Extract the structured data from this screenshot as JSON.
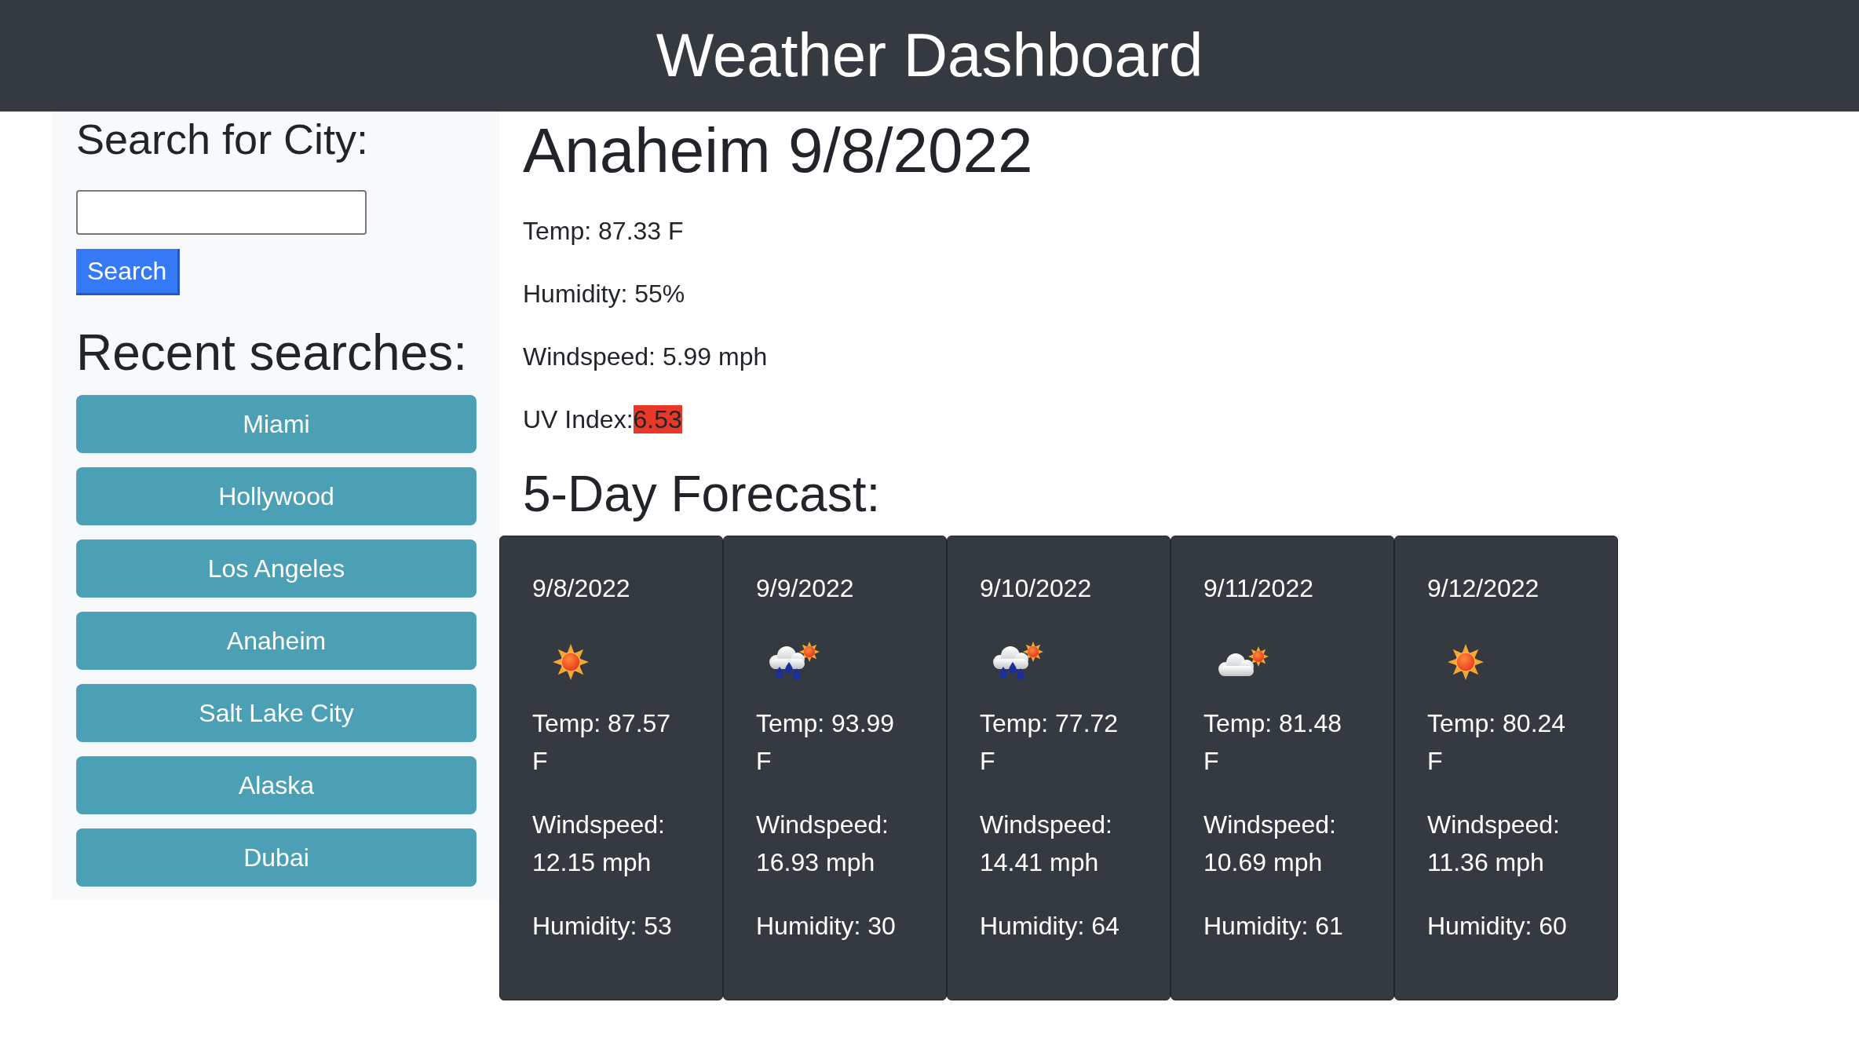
{
  "header": {
    "title": "Weather Dashboard"
  },
  "sidebar": {
    "search_heading": "Search for City:",
    "search_button": "Search",
    "recent_heading": "Recent searches:",
    "recent_searches": [
      "Miami",
      "Hollywood",
      "Los Angeles",
      "Anaheim",
      "Salt Lake City",
      "Alaska",
      "Dubai"
    ]
  },
  "current": {
    "title": "Anaheim 9/8/2022",
    "temp": "Temp: 87.33 F",
    "humidity": "Humidity: 55%",
    "windspeed": "Windspeed: 5.99 mph",
    "uv_label": "UV Index:",
    "uv_value": "6.53"
  },
  "forecast": {
    "heading": "5-Day Forecast:",
    "days": [
      {
        "date": "9/8/2022",
        "kind": "sunny",
        "temp": "Temp: 87.57 F",
        "windspeed": "Windspeed: 12.15 mph",
        "humidity": "Humidity: 53"
      },
      {
        "date": "9/9/2022",
        "kind": "rain",
        "temp": "Temp: 93.99 F",
        "windspeed": "Windspeed: 16.93 mph",
        "humidity": "Humidity: 30"
      },
      {
        "date": "9/10/2022",
        "kind": "rain",
        "temp": "Temp: 77.72 F",
        "windspeed": "Windspeed: 14.41 mph",
        "humidity": "Humidity: 64"
      },
      {
        "date": "9/11/2022",
        "kind": "partly-cloudy",
        "temp": "Temp: 81.48 F",
        "windspeed": "Windspeed: 10.69 mph",
        "humidity": "Humidity: 61"
      },
      {
        "date": "9/12/2022",
        "kind": "sunny",
        "temp": "Temp: 80.24 F",
        "windspeed": "Windspeed: 11.36 mph",
        "humidity": "Humidity: 60"
      }
    ]
  }
}
